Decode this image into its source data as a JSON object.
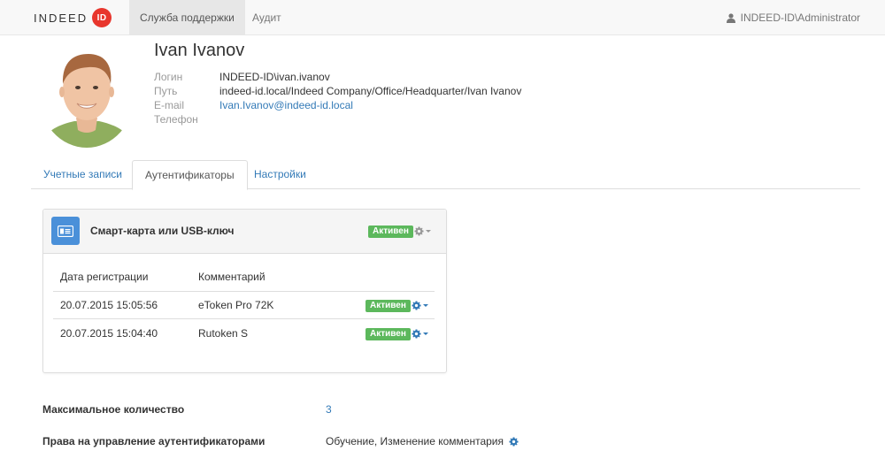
{
  "navbar": {
    "logo_text": "INDEED",
    "logo_badge": "ID",
    "tabs": [
      {
        "label": "Служба поддержки"
      },
      {
        "label": "Аудит"
      }
    ],
    "user": "INDEED-ID\\Administrator",
    "user_icon": "user-icon"
  },
  "profile": {
    "name": "Ivan Ivanov",
    "fields": [
      {
        "label": "Логин",
        "value": "INDEED-ID\\ivan.ivanov"
      },
      {
        "label": "Путь",
        "value": "indeed-id.local/Indeed Company/Office/Headquarter/Ivan Ivanov"
      },
      {
        "label": "E-mail",
        "value": "Ivan.Ivanov@indeed-id.local"
      },
      {
        "label": "Телефон",
        "value": ""
      }
    ]
  },
  "tabs": [
    {
      "label": "Учетные записи"
    },
    {
      "label": "Аутентификаторы"
    },
    {
      "label": "Настройки"
    }
  ],
  "panel": {
    "icon": "smartcard-icon",
    "title": "Смарт-карта или USB-ключ",
    "status": "Активен",
    "columns": [
      "Дата регистрации",
      "Комментарий"
    ],
    "rows": [
      {
        "date": "20.07.2015 15:05:56",
        "comment": "eToken Pro 72K",
        "status": "Активен"
      },
      {
        "date": "20.07.2015 15:04:40",
        "comment": "Rutoken S",
        "status": "Активен"
      }
    ]
  },
  "settings": {
    "max_count_label": "Максимальное количество",
    "max_count_value": "3",
    "rights_label": "Права на управление аутентификаторами",
    "rights_value": "Обучение, Изменение комментария"
  },
  "colors": {
    "accent": "#337ab7",
    "active_badge": "#5cb85c",
    "logo_red": "#e8362d",
    "icon_tile": "#4a90d9"
  }
}
